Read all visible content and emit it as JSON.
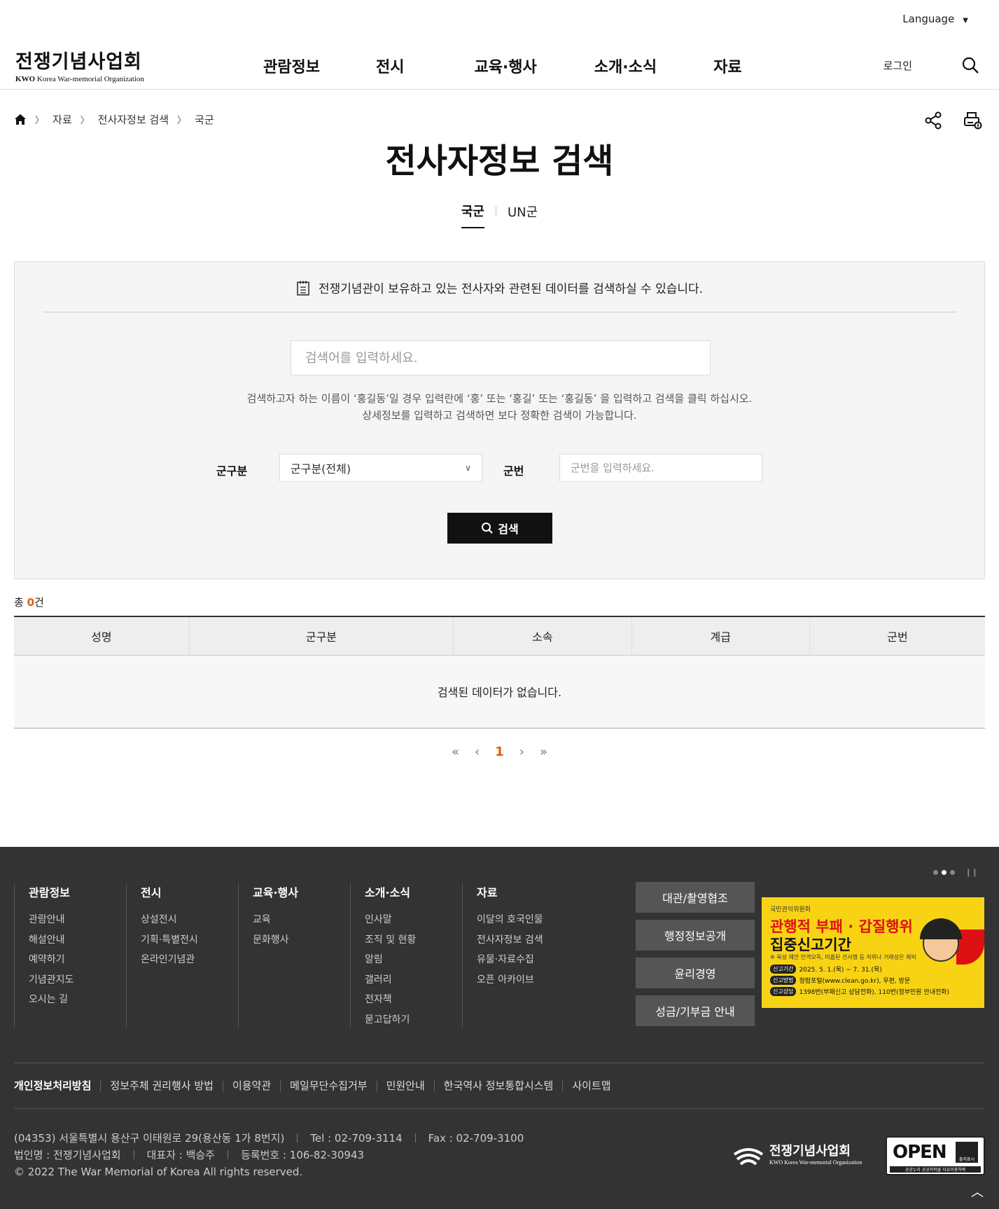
{
  "header": {
    "language": "Language",
    "logo_ko": "전쟁기념사업회",
    "logo_en_bold": "KWO",
    "logo_en": "Korea War-memorial Organization",
    "nav": [
      "관람정보",
      "전시",
      "교육·행사",
      "소개·소식",
      "자료"
    ],
    "login": "로그인"
  },
  "breadcrumb": [
    "자료",
    "전사자정보 검색",
    "국군"
  ],
  "page_title": "전사자정보 검색",
  "tabs": [
    {
      "label": "국군",
      "active": true
    },
    {
      "label": "UN군",
      "active": false
    }
  ],
  "search": {
    "intro": "전쟁기념관이 보유하고 있는 전사자와 관련된 데이터를 검색하실 수 있습니다.",
    "keyword_placeholder": "검색어를 입력하세요.",
    "help_line1": "검색하고자 하는 이름이 ‘홍길동’일 경우 입력란에 ‘홍’ 또는 ‘홍길’ 또는 ‘홍길동’ 을 입력하고 검색을 클릭 하십시오.",
    "help_line2": "상세정보를 입력하고 검색하면 보다 정확한 검색이 가능합니다.",
    "branch_label": "군구분",
    "branch_selected": "군구분(전체)",
    "number_label": "군번",
    "number_placeholder": "군번을 입력하세요.",
    "button": "검색"
  },
  "results": {
    "total_prefix": "총 ",
    "total_count": "0",
    "total_suffix": "건",
    "columns": [
      "성명",
      "군구분",
      "소속",
      "계급",
      "군번"
    ],
    "empty_message": "검색된 데이터가 없습니다."
  },
  "pager": {
    "first": "«",
    "prev": "‹",
    "current": "1",
    "next": "›",
    "last": "»"
  },
  "footer": {
    "columns": [
      {
        "title": "관람정보",
        "items": [
          "관람안내",
          "해설안내",
          "예약하기",
          "기념관지도",
          "오시는 길"
        ]
      },
      {
        "title": "전시",
        "items": [
          "상설전시",
          "기획·특별전시",
          "온라인기념관"
        ]
      },
      {
        "title": "교육·행사",
        "items": [
          "교육",
          "문화행사"
        ]
      },
      {
        "title": "소개·소식",
        "items": [
          "인사말",
          "조직 및 현황",
          "알림",
          "갤러리",
          "전자책",
          "묻고답하기"
        ]
      },
      {
        "title": "자료",
        "items": [
          "이달의 호국인물",
          "전사자정보 검색",
          "유물·자료수집",
          "오픈 아카이브"
        ]
      }
    ],
    "buttons": [
      "대관/촬영협조",
      "행정정보공개",
      "윤리경영",
      "성금/기부금 안내"
    ],
    "banner": {
      "org": "국민권익위원회",
      "title1": "관행적 부패 · 갑질행위",
      "title2": "집중신고기간",
      "note": "※ 육성 제안 인격모독, 미흡된 선서행 등 직위나 거래성은 제외",
      "row1_tag": "신고기간",
      "row1": "2025. 5. 1.(목) ~ 7. 31.(목)",
      "row2_tag": "신고방법",
      "row2": "청렴포털(www.clean.go.kr), 우편, 방문",
      "row3_tag": "신고상담",
      "row3": "1398번(부패신고 상담전화), 110번(정부민원 안내전화)"
    },
    "links": [
      "개인정보처리방침",
      "정보주체 권리행사 방법",
      "이용약관",
      "메일무단수집거부",
      "민원안내",
      "한국역사 정보통합시스템",
      "사이트맵"
    ],
    "address": "(04353) 서울특별시 용산구 이태원로 29(용산동 1가 8번지)",
    "tel": "Tel : 02-709-3114",
    "fax": "Fax : 02-709-3100",
    "corp": "법인명 : 전쟁기념사업회",
    "ceo": "대표자 : 백승주",
    "reg": "등록번호 : 106-82-30943",
    "copyright": "© 2022 The War Memorial of Korea All rights reserved.",
    "logo_ko": "전쟁기념사업회",
    "logo_en": "KWO Korea War-memorial Organization",
    "open_word": "OPEN",
    "open_badge": "출처표시",
    "open_sub": "공공누리 공공저작물 자유이용허락"
  }
}
